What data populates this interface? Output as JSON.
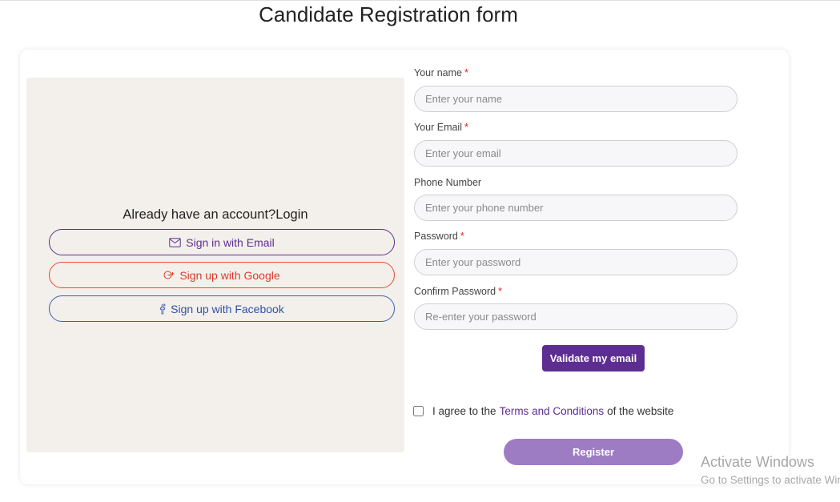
{
  "page": {
    "title": "Candidate Registration form"
  },
  "left_panel": {
    "login_prompt": "Already have an account?Login",
    "buttons": {
      "email": {
        "label": "Sign in with Email",
        "icon": "envelope-icon",
        "color": "#5e2d91"
      },
      "google": {
        "label": "Sign up with Google",
        "icon": "google-plus-icon",
        "color": "#d93a2a"
      },
      "facebook": {
        "label": "Sign up with Facebook",
        "icon": "facebook-icon",
        "color": "#2f4fa8"
      }
    }
  },
  "form": {
    "name": {
      "label": "Your name",
      "required_mark": "*",
      "placeholder": "Enter your name",
      "value": ""
    },
    "email": {
      "label": "Your Email",
      "required_mark": "*",
      "placeholder": "Enter your email",
      "value": ""
    },
    "phone": {
      "label": "Phone Number",
      "placeholder": "Enter your phone number",
      "value": ""
    },
    "password": {
      "label": "Password",
      "required_mark": "*",
      "placeholder": "Enter your password",
      "value": ""
    },
    "confirm_password": {
      "label": "Confirm Password",
      "required_mark": "*",
      "placeholder": "Re-enter your password",
      "value": ""
    },
    "validate_button": "Validate my email",
    "agree": {
      "prefix": "I agree to the",
      "link": "Terms and Conditions",
      "suffix": "of the website",
      "checked": false
    },
    "register_button": "Register"
  },
  "watermark": {
    "title": "Activate Windows",
    "subtitle": "Go to Settings to activate Windows."
  },
  "colors": {
    "accent": "#5e2d91",
    "register": "#9e7cc4",
    "panel_bg": "#f3f0eb",
    "required": "#dd2222"
  }
}
